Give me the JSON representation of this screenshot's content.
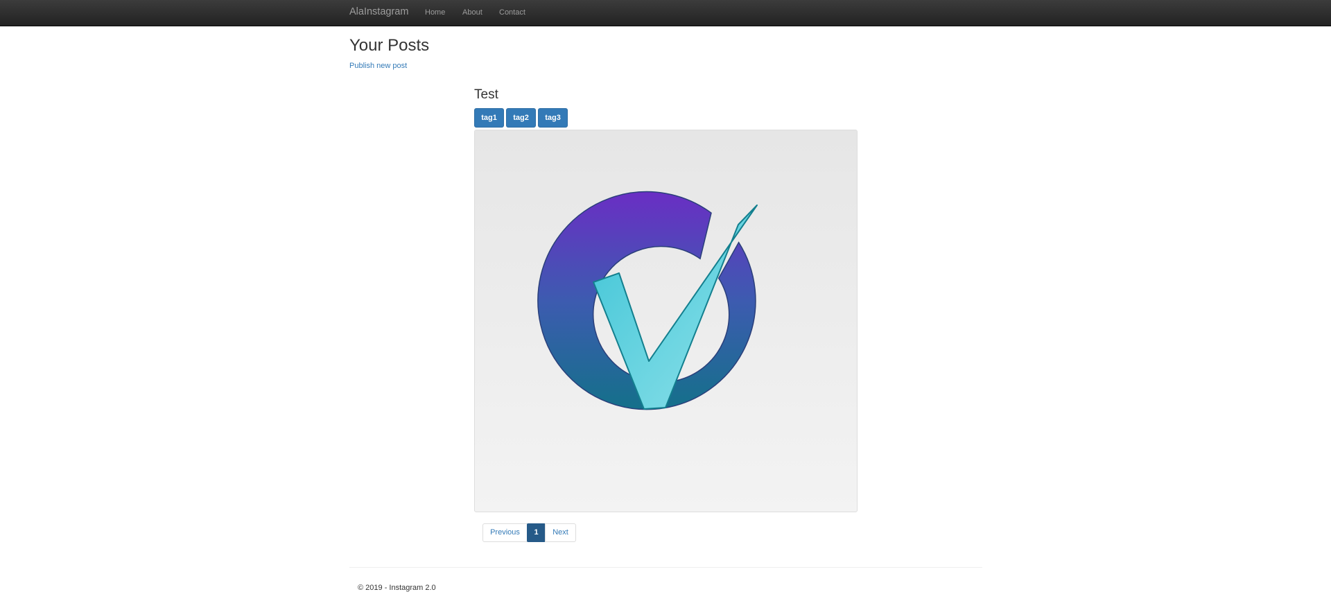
{
  "navbar": {
    "brand": "AlaInstagram",
    "links": [
      {
        "label": "Home"
      },
      {
        "label": "About"
      },
      {
        "label": "Contact"
      }
    ]
  },
  "page": {
    "title": "Your Posts",
    "publish_link": "Publish new post"
  },
  "post": {
    "title": "Test",
    "tags": [
      "tag1",
      "tag2",
      "tag3"
    ],
    "image_icon": "checkmark-circle-logo-icon"
  },
  "pagination": {
    "previous": "Previous",
    "current": "1",
    "next": "Next"
  },
  "footer": {
    "text": "© 2019 - Instagram 2.0"
  },
  "colors": {
    "navbar": "#222222",
    "link": "#337ab7",
    "tag": "#337ab7",
    "pager_active": "#265a88",
    "ring_top": "#6a2ec4",
    "ring_bottom": "#14708a",
    "check": "#5fd0de"
  }
}
